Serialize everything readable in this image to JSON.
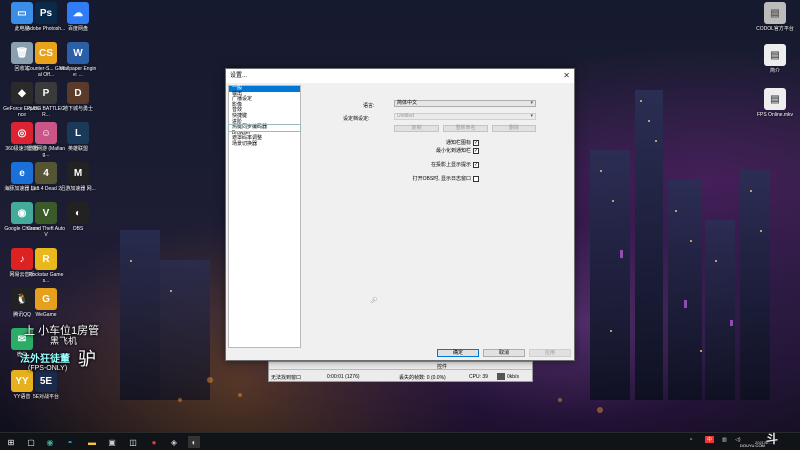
{
  "desktop": {
    "left_icons": [
      {
        "label": "此电脑",
        "icon": "computer-icon",
        "color": "#3a8ee6",
        "glyph": "▭"
      },
      {
        "label": "Adobe Photosh...",
        "icon": "photoshop-icon",
        "color": "#0b2a4a",
        "glyph": "Ps"
      },
      {
        "label": "百度网盘",
        "icon": "baidu-netdisk-icon",
        "color": "#2f7cf6",
        "glyph": "☁"
      },
      {
        "label": "回收站",
        "icon": "recycle-bin-icon",
        "color": "#8aa0b0",
        "glyph": "🗑"
      },
      {
        "label": "Counter-S... Global Off...",
        "icon": "csgo-icon",
        "color": "#e8a21c",
        "glyph": "CS"
      },
      {
        "label": "Wallpaper Engine: ...",
        "icon": "wallpaper-engine-icon",
        "color": "#2b5fa8",
        "glyph": "W"
      },
      {
        "label": "GeForce Experience",
        "icon": "geforce-icon",
        "color": "#2a2a2a",
        "glyph": "◆"
      },
      {
        "label": "PUBG BATTLEGR...",
        "icon": "pubg-icon",
        "color": "#3a3a3a",
        "glyph": "P"
      },
      {
        "label": "地下城与勇士",
        "icon": "dnf-icon",
        "color": "#5a3a2a",
        "glyph": "D"
      },
      {
        "label": "360极速浏览器",
        "icon": "360-browser-icon",
        "color": "#d23",
        "glyph": "◎"
      },
      {
        "label": "雷霆网游 (Mafiang...",
        "icon": "game-girl-icon",
        "color": "#c58",
        "glyph": "☺"
      },
      {
        "label": "英雄联盟",
        "icon": "lol-icon",
        "color": "#1b3a5a",
        "glyph": "L"
      },
      {
        "label": "海豚加速器 加...",
        "icon": "dolphin-accel-icon",
        "color": "#1a6fd8",
        "glyph": "e"
      },
      {
        "label": "Left 4 Dead 2",
        "icon": "l4d2-icon",
        "color": "#553",
        "glyph": "4"
      },
      {
        "label": "迅游加速器 网...",
        "icon": "xunyou-icon",
        "color": "#222",
        "glyph": "M"
      },
      {
        "label": "Google Chrome",
        "icon": "chrome-icon",
        "color": "#4a9",
        "glyph": "◉"
      },
      {
        "label": "Grand Theft Auto V",
        "icon": "gta-icon",
        "color": "#3a5a2a",
        "glyph": "V"
      },
      {
        "label": "OBS",
        "icon": "obs-icon",
        "color": "#222",
        "glyph": "◐"
      },
      {
        "label": "网易云音乐",
        "icon": "netease-music-icon",
        "color": "#d22",
        "glyph": "♪"
      },
      {
        "label": "Rockstar Games...",
        "icon": "rockstar-icon",
        "color": "#e9b81c",
        "glyph": "R"
      },
      {
        "label": "腾讯QQ",
        "icon": "qq-icon",
        "color": "#222",
        "glyph": "🐧"
      },
      {
        "label": "WeGame",
        "icon": "wegame-icon",
        "color": "#e6a11c",
        "glyph": "G"
      },
      {
        "label": "微信",
        "icon": "wechat-icon",
        "color": "#2aae67",
        "glyph": "✉"
      },
      {
        "label": "YY语音",
        "icon": "yy-icon",
        "color": "#e6b11c",
        "glyph": "YY"
      },
      {
        "label": "5E对战平台",
        "icon": "5e-icon",
        "color": "#1a2a4a",
        "glyph": "5E"
      }
    ],
    "right_icons": [
      {
        "label": "CODOL官方平台",
        "icon": "codol-icon",
        "color": "#bbb",
        "glyph": "▤"
      },
      {
        "label": "简介",
        "icon": "doc-icon",
        "color": "#eee",
        "glyph": "▤"
      },
      {
        "label": "FPS Online.mkv",
        "icon": "video-file-icon",
        "color": "#eee",
        "glyph": "▤"
      }
    ]
  },
  "overlay": {
    "line1": "上 小车位1房管",
    "line2": "黑飞机",
    "line3": "法外狂徒董",
    "line4": "(FPS-ONLY)",
    "line5": "驴"
  },
  "dialog": {
    "title": "设置...",
    "close_glyph": "✕",
    "sidebar": [
      "一般",
      "输出",
      "广播设定",
      "影像",
      "音效",
      "快捷键",
      "进阶",
      "热键同步编码器",
      "Browser",
      "遮罩码率调整",
      "场景切换器"
    ],
    "selected_index": 0,
    "language_label": "语言:",
    "language_value": "简体中文",
    "profile_label": "设定档设定:",
    "profile_value": "Untitled",
    "profile_buttons": [
      "复制",
      "重新命名",
      "删除"
    ],
    "checks": [
      {
        "label": "通知栏图标",
        "checked": true
      },
      {
        "label": "最小化到通知栏",
        "checked": true
      },
      {
        "label": "在投影上显示提示",
        "checked": true
      },
      {
        "label": "打开OBS时, 显示日志窗口",
        "checked": false
      }
    ],
    "buttons": {
      "ok": "确定",
      "cancel": "取消",
      "apply": "应用"
    }
  },
  "obs_status": {
    "controls": "控件",
    "left_text": "无法找到窗口",
    "time": "0:00:01 (1276)",
    "recording": "丢失的帧数: 0 (0.0%)",
    "cpu": "CPU: 39",
    "bitrate": "0kb/s"
  },
  "taskbar": {
    "items": [
      "windows-icon",
      "task-view-icon",
      "chrome-icon",
      "edge-icon",
      "file-explorer-icon",
      "store-icon",
      "netease-icon",
      "photos-icon",
      "obs-icon"
    ],
    "tray_lang": "中",
    "date": "2021/5/..."
  },
  "watermark": "DOUYU.COM"
}
